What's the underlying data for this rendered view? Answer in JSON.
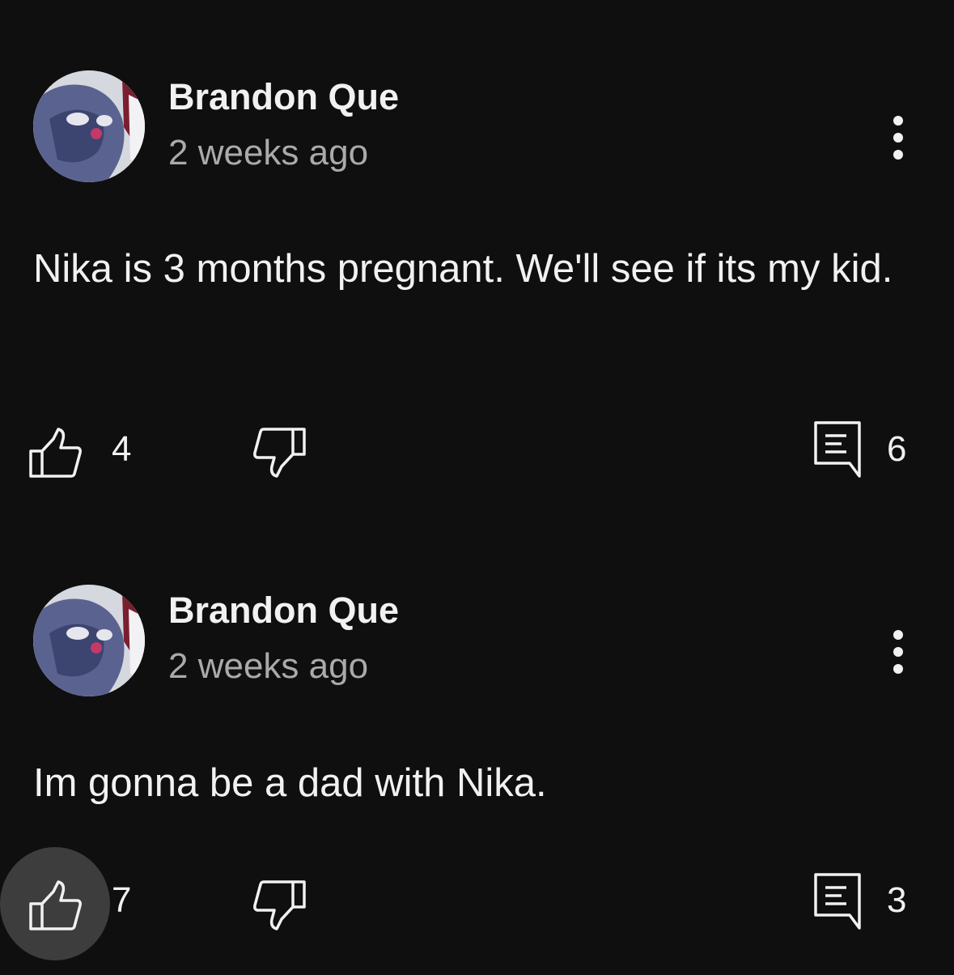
{
  "comments": [
    {
      "author": "Brandon Que",
      "time": "2 weeks ago",
      "text": "Nika is 3 months pregnant. We'll see if its my kid.",
      "likes": "4",
      "replies": "6",
      "like_pressed": false
    },
    {
      "author": "Brandon Que",
      "time": "2 weeks ago",
      "text": "Im gonna be a dad with Nika.",
      "likes": "7",
      "replies": "3",
      "like_pressed": true
    }
  ],
  "icons": {
    "like": "thumbs-up-icon",
    "dislike": "thumbs-down-icon",
    "reply": "reply-comment-icon",
    "more": "more-vertical-icon"
  },
  "colors": {
    "background": "#0f0f0f",
    "text": "#f1f1f1",
    "secondary_text": "#aaaaaa",
    "pressed_highlight": "#3d3d3d"
  }
}
